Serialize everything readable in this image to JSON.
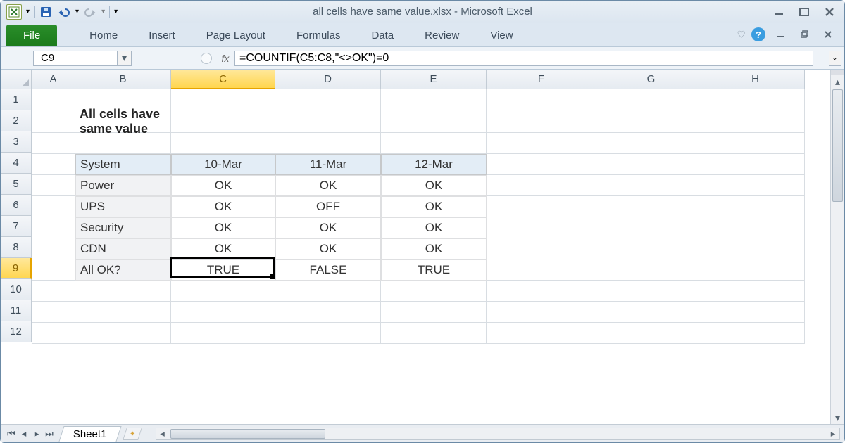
{
  "window": {
    "title": "all cells have same value.xlsx  -  Microsoft Excel"
  },
  "ribbon": {
    "file": "File",
    "tabs": [
      "Home",
      "Insert",
      "Page Layout",
      "Formulas",
      "Data",
      "Review",
      "View"
    ]
  },
  "namebox": "C9",
  "formula": "=COUNTIF(C5:C8,\"<>OK\")=0",
  "columns": [
    "A",
    "B",
    "C",
    "D",
    "E",
    "F",
    "G",
    "H"
  ],
  "row_count": 12,
  "selected_col": "C",
  "selected_row": 9,
  "content_title": "All cells have same value",
  "table": {
    "header": [
      "System",
      "10-Mar",
      "11-Mar",
      "12-Mar"
    ],
    "rows": [
      [
        "Power",
        "OK",
        "OK",
        "OK"
      ],
      [
        "UPS",
        "OK",
        "OFF",
        "OK"
      ],
      [
        "Security",
        "OK",
        "OK",
        "OK"
      ],
      [
        "CDN",
        "OK",
        "OK",
        "OK"
      ],
      [
        "All OK?",
        "TRUE",
        "FALSE",
        "TRUE"
      ]
    ]
  },
  "sheet_tab": "Sheet1",
  "chart_data": {
    "type": "table",
    "title": "All cells have same value",
    "columns": [
      "System",
      "10-Mar",
      "11-Mar",
      "12-Mar"
    ],
    "rows": [
      [
        "Power",
        "OK",
        "OK",
        "OK"
      ],
      [
        "UPS",
        "OK",
        "OFF",
        "OK"
      ],
      [
        "Security",
        "OK",
        "OK",
        "OK"
      ],
      [
        "CDN",
        "OK",
        "OK",
        "OK"
      ],
      [
        "All OK?",
        "TRUE",
        "FALSE",
        "TRUE"
      ]
    ],
    "formula_in_C9": "=COUNTIF(C5:C8,\"<>OK\")=0"
  }
}
